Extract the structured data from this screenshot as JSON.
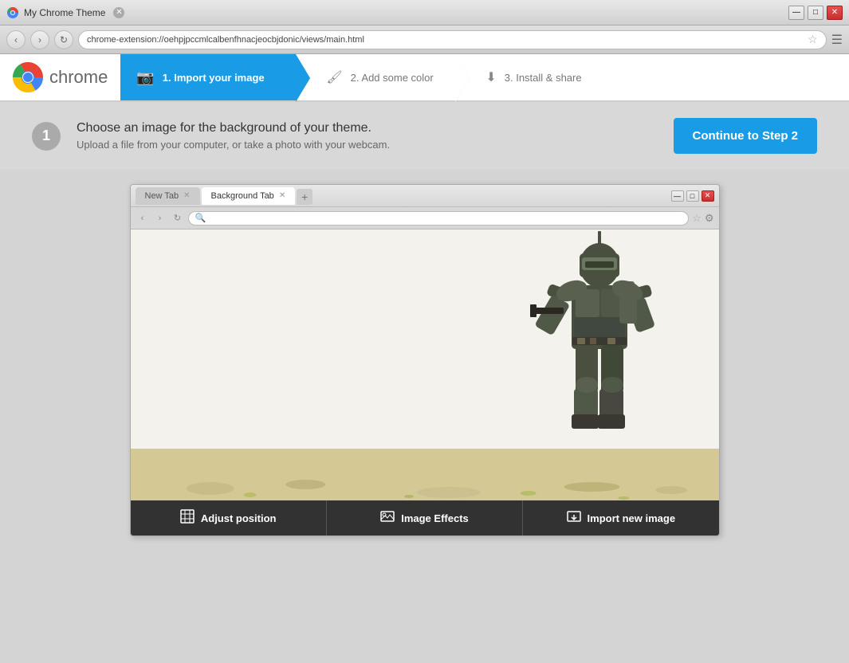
{
  "titlebar": {
    "title": "My Chrome Theme",
    "controls": {
      "minimize": "—",
      "maximize": "□",
      "close": "✕"
    }
  },
  "navbar": {
    "address": "chrome-extension://oehpjpccmlcalbenfhnacjeocbjdonic/views/main.html",
    "back": "‹",
    "forward": "›",
    "refresh": "↻"
  },
  "steps": {
    "step1": {
      "number": "1",
      "icon": "📷",
      "label": "1. Import your image"
    },
    "step2": {
      "icon": "🖌",
      "label": "2. Add some color"
    },
    "step3": {
      "icon": "⬇",
      "label": "3. Install & share"
    }
  },
  "info": {
    "step_number": "1",
    "title": "Choose an image for the background of your theme.",
    "subtitle": "Upload a file from your computer, or take a photo with your webcam.",
    "continue_button": "Continue to Step 2"
  },
  "preview": {
    "tab_new": "New Tab",
    "tab_background": "Background Tab",
    "win_minimize": "—",
    "win_maximize": "□",
    "win_close": "✕",
    "nav_back": "‹",
    "nav_forward": "›",
    "nav_refresh": "↻"
  },
  "toolbar": {
    "adjust_label": "Adjust position",
    "effects_label": "Image Effects",
    "import_label": "Import new image",
    "adjust_icon": "⊞",
    "effects_icon": "⊟",
    "import_icon": "⊠"
  },
  "chrome_logo_text": "chrome"
}
